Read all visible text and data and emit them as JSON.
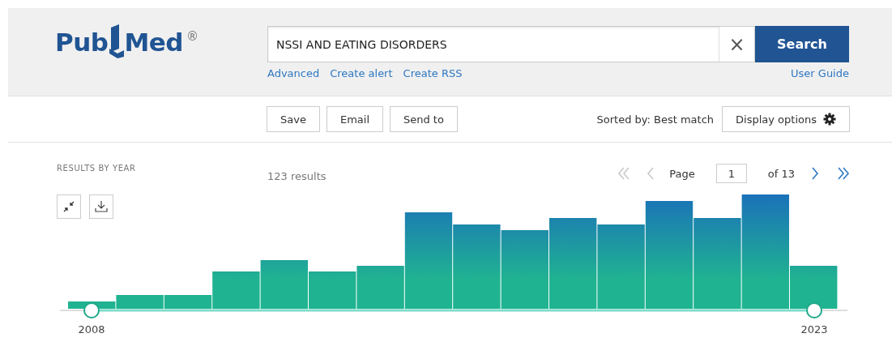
{
  "logo": {
    "parts": [
      "Pub",
      "Med"
    ],
    "mark": "®"
  },
  "search": {
    "value": "NSSI AND EATING DISORDERS",
    "clear": "×",
    "button": "Search"
  },
  "links": [
    "Advanced",
    "Create alert",
    "Create RSS"
  ],
  "user_guide": "User Guide",
  "actions": [
    "Save",
    "Email",
    "Send to"
  ],
  "sorted_by": "Sorted by: Best match",
  "display_options": "Display options",
  "results_by_year": {
    "title": "RESULTS BY YEAR",
    "handles": [
      {
        "label": "2008"
      },
      {
        "label": "2023"
      }
    ]
  },
  "result_count": "123 results",
  "pagination": {
    "page_label": "Page",
    "page": "1",
    "of": "of 13",
    "buttons": [
      {
        "kind": "first",
        "disabled": true
      },
      {
        "kind": "prev",
        "disabled": true
      },
      {
        "kind": "next",
        "disabled": false
      },
      {
        "kind": "last",
        "disabled": false
      }
    ]
  }
}
